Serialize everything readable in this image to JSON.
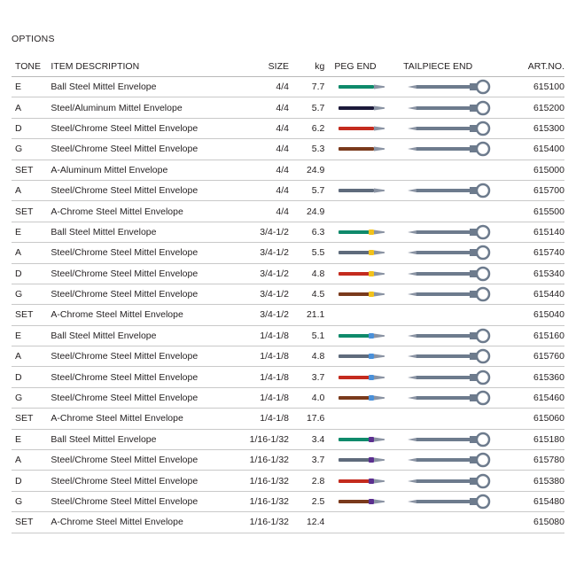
{
  "section_title": "OPTIONS",
  "headers": {
    "tone": "TONE",
    "description": "ITEM DESCRIPTION",
    "size": "SIZE",
    "kg": "kg",
    "peg": "PEG END",
    "tail": "TAILPIECE END",
    "art": "ART.NO."
  },
  "icons": {
    "peg": "peg-end-icon",
    "tail": "tailpiece-end-icon"
  },
  "colors": {
    "rod": "#6d7b8d",
    "tip": "#8a93a3",
    "text": "#231f20",
    "rule": "#c9c9c9"
  },
  "rows": [
    {
      "tone": "E",
      "description": "Ball Steel Mittel Envelope",
      "size": "4/4",
      "kg": "7.7",
      "art": "615100",
      "peg_color": "#0f8a6b",
      "band": "",
      "tail": true
    },
    {
      "tone": "A",
      "description": "Steel/Aluminum Mittel Envelope",
      "size": "4/4",
      "kg": "5.7",
      "art": "615200",
      "peg_color": "#1c1a3a",
      "band": "",
      "tail": true
    },
    {
      "tone": "D",
      "description": "Steel/Chrome Steel Mittel Envelope",
      "size": "4/4",
      "kg": "6.2",
      "art": "615300",
      "peg_color": "#c42b1e",
      "band": "",
      "tail": true
    },
    {
      "tone": "G",
      "description": "Steel/Chrome Steel Mittel Envelope",
      "size": "4/4",
      "kg": "5.3",
      "art": "615400",
      "peg_color": "#7a3a1c",
      "band": "",
      "tail": true
    },
    {
      "tone": "SET",
      "description": "A-Aluminum Mittel Envelope",
      "size": "4/4",
      "kg": "24.9",
      "art": "615000",
      "peg_color": "",
      "band": "",
      "tail": false
    },
    {
      "tone": "A",
      "description": "Steel/Chrome Steel Mittel Envelope",
      "size": "4/4",
      "kg": "5.7",
      "art": "615700",
      "peg_color": "#5f6b7c",
      "band": "",
      "tail": true
    },
    {
      "tone": "SET",
      "description": "A-Chrome Steel Mittel Envelope",
      "size": "4/4",
      "kg": "24.9",
      "art": "615500",
      "peg_color": "",
      "band": "",
      "tail": false
    },
    {
      "tone": "E",
      "description": "Ball Steel Mittel Envelope",
      "size": "3/4-1/2",
      "kg": "6.3",
      "art": "615140",
      "peg_color": "#0f8a6b",
      "band": "#f2c21b",
      "tail": true
    },
    {
      "tone": "A",
      "description": "Steel/Chrome Steel Mittel Envelope",
      "size": "3/4-1/2",
      "kg": "5.5",
      "art": "615740",
      "peg_color": "#5f6b7c",
      "band": "#f2c21b",
      "tail": true
    },
    {
      "tone": "D",
      "description": "Steel/Chrome Steel Mittel Envelope",
      "size": "3/4-1/2",
      "kg": "4.8",
      "art": "615340",
      "peg_color": "#c42b1e",
      "band": "#f2c21b",
      "tail": true
    },
    {
      "tone": "G",
      "description": "Steel/Chrome Steel Mittel Envelope",
      "size": "3/4-1/2",
      "kg": "4.5",
      "art": "615440",
      "peg_color": "#7a3a1c",
      "band": "#f2c21b",
      "tail": true
    },
    {
      "tone": "SET",
      "description": "A-Chrome Steel Mittel Envelope",
      "size": "3/4-1/2",
      "kg": "21.1",
      "art": "615040",
      "peg_color": "",
      "band": "",
      "tail": false
    },
    {
      "tone": "E",
      "description": "Ball Steel Mittel Envelope",
      "size": "1/4-1/8",
      "kg": "5.1",
      "art": "615160",
      "peg_color": "#0f8a6b",
      "band": "#4a90d9",
      "tail": true
    },
    {
      "tone": "A",
      "description": "Steel/Chrome Steel Mittel Envelope",
      "size": "1/4-1/8",
      "kg": "4.8",
      "art": "615760",
      "peg_color": "#5f6b7c",
      "band": "#4a90d9",
      "tail": true
    },
    {
      "tone": "D",
      "description": "Steel/Chrome Steel Mittel Envelope",
      "size": "1/4-1/8",
      "kg": "3.7",
      "art": "615360",
      "peg_color": "#c42b1e",
      "band": "#4a90d9",
      "tail": true
    },
    {
      "tone": "G",
      "description": "Steel/Chrome Steel Mittel Envelope",
      "size": "1/4-1/8",
      "kg": "4.0",
      "art": "615460",
      "peg_color": "#7a3a1c",
      "band": "#4a90d9",
      "tail": true
    },
    {
      "tone": "SET",
      "description": "A-Chrome Steel Mittel Envelope",
      "size": "1/4-1/8",
      "kg": "17.6",
      "art": "615060",
      "peg_color": "",
      "band": "",
      "tail": false
    },
    {
      "tone": "E",
      "description": "Ball Steel Mittel Envelope",
      "size": "1/16-1/32",
      "kg": "3.4",
      "art": "615180",
      "peg_color": "#0f8a6b",
      "band": "#5b2f8f",
      "tail": true
    },
    {
      "tone": "A",
      "description": "Steel/Chrome Steel Mittel Envelope",
      "size": "1/16-1/32",
      "kg": "3.7",
      "art": "615780",
      "peg_color": "#5f6b7c",
      "band": "#5b2f8f",
      "tail": true
    },
    {
      "tone": "D",
      "description": "Steel/Chrome Steel Mittel Envelope",
      "size": "1/16-1/32",
      "kg": "2.8",
      "art": "615380",
      "peg_color": "#c42b1e",
      "band": "#5b2f8f",
      "tail": true
    },
    {
      "tone": "G",
      "description": "Steel/Chrome Steel Mittel Envelope",
      "size": "1/16-1/32",
      "kg": "2.5",
      "art": "615480",
      "peg_color": "#7a3a1c",
      "band": "#5b2f8f",
      "tail": true
    },
    {
      "tone": "SET",
      "description": "A-Chrome Steel Mittel Envelope",
      "size": "1/16-1/32",
      "kg": "12.4",
      "art": "615080",
      "peg_color": "",
      "band": "",
      "tail": false
    }
  ]
}
